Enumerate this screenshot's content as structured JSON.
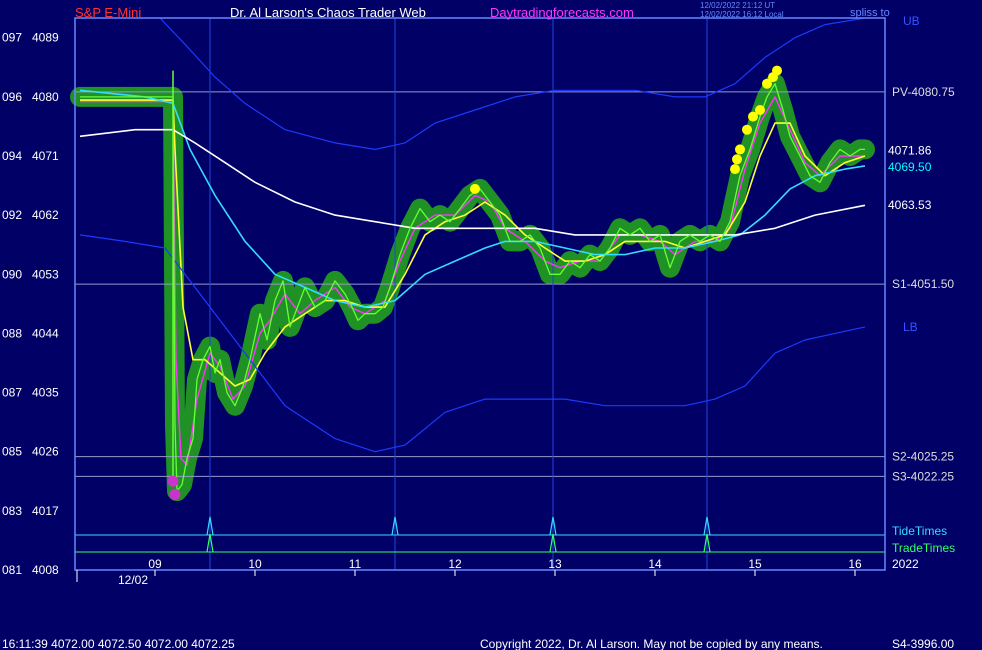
{
  "header": {
    "title": "S&P E-Mini",
    "author": "Dr. Al Larson's Chaos Trader Web",
    "site": "Daytradingforecasts.com",
    "timestamp_ut": "12/02/2022 21:12 UT",
    "timestamp_local": "12/02/2022 16:12 Local",
    "corner_label": "spliss to"
  },
  "footer": {
    "last_bar": "16:11:39  4072.00 4072.50 4072.00 4072.25",
    "copyright": "Copyright 2022, Dr. Al Larson. May not be copied by any means.",
    "s4_label": "S4-3996.00"
  },
  "axis": {
    "y_ticks": [
      {
        "left": "097",
        "right": "4089",
        "value": 4089
      },
      {
        "left": "096",
        "right": "4080",
        "value": 4080
      },
      {
        "left": "094",
        "right": "4071",
        "value": 4071
      },
      {
        "left": "092",
        "right": "4062",
        "value": 4062
      },
      {
        "left": "090",
        "right": "4053",
        "value": 4053
      },
      {
        "left": "088",
        "right": "4044",
        "value": 4044
      },
      {
        "left": "087",
        "right": "4035",
        "value": 4035
      },
      {
        "left": "085",
        "right": "4026",
        "value": 4026
      },
      {
        "left": "083",
        "right": "4017",
        "value": 4017
      },
      {
        "left": "081",
        "right": "4008",
        "value": 4008
      }
    ],
    "x_ticks": [
      {
        "label": "09",
        "hour": 9
      },
      {
        "label": "10",
        "hour": 10
      },
      {
        "label": "11",
        "hour": 11
      },
      {
        "label": "12",
        "hour": 12
      },
      {
        "label": "13",
        "hour": 13
      },
      {
        "label": "14",
        "hour": 14
      },
      {
        "label": "15",
        "hour": 15
      },
      {
        "label": "16",
        "hour": 16
      }
    ],
    "date_label": "12/02",
    "year_label": "2022",
    "x_range": [
      8.2,
      16.3
    ],
    "y_range": [
      4008,
      4092
    ]
  },
  "chart_data": {
    "type": "line",
    "levels": [
      {
        "label": "PV-4080.75",
        "value": 4080.75
      },
      {
        "label": "S1-4051.50",
        "value": 4051.5
      },
      {
        "label": "S2-4025.25",
        "value": 4025.25
      },
      {
        "label": "S3-4022.25",
        "value": 4022.25
      }
    ],
    "band_labels": {
      "upper": "UB",
      "lower": "LB"
    },
    "value_labels": [
      {
        "label": "4071.86",
        "value": 4071.86,
        "color": "#ffffff"
      },
      {
        "label": "4069.50",
        "value": 4069.5,
        "color": "#00ffff"
      },
      {
        "label": "4063.53",
        "value": 4063.53,
        "color": "#ffffff"
      }
    ],
    "price": [
      [
        8.25,
        4080.0
      ],
      [
        8.9,
        4080.0
      ],
      [
        9.18,
        4080.0
      ],
      [
        9.2,
        4030
      ],
      [
        9.22,
        4020
      ],
      [
        9.27,
        4021
      ],
      [
        9.32,
        4025
      ],
      [
        9.38,
        4028
      ],
      [
        9.42,
        4037
      ],
      [
        9.48,
        4040
      ],
      [
        9.55,
        4042
      ],
      [
        9.6,
        4038
      ],
      [
        9.65,
        4040
      ],
      [
        9.72,
        4035
      ],
      [
        9.8,
        4033
      ],
      [
        9.88,
        4036
      ],
      [
        9.95,
        4040
      ],
      [
        10.05,
        4047
      ],
      [
        10.12,
        4043
      ],
      [
        10.2,
        4049
      ],
      [
        10.28,
        4052
      ],
      [
        10.35,
        4045
      ],
      [
        10.4,
        4047
      ],
      [
        10.5,
        4051
      ],
      [
        10.6,
        4048
      ],
      [
        10.7,
        4049
      ],
      [
        10.8,
        4052
      ],
      [
        10.9,
        4050
      ],
      [
        10.97,
        4048
      ],
      [
        11.03,
        4046
      ],
      [
        11.1,
        4047
      ],
      [
        11.2,
        4047
      ],
      [
        11.28,
        4048
      ],
      [
        11.35,
        4051
      ],
      [
        11.45,
        4056
      ],
      [
        11.55,
        4060
      ],
      [
        11.65,
        4063
      ],
      [
        11.75,
        4061
      ],
      [
        11.85,
        4062
      ],
      [
        11.95,
        4061
      ],
      [
        12.05,
        4063
      ],
      [
        12.15,
        4065
      ],
      [
        12.25,
        4066
      ],
      [
        12.35,
        4064
      ],
      [
        12.45,
        4062
      ],
      [
        12.55,
        4058
      ],
      [
        12.65,
        4058
      ],
      [
        12.75,
        4059
      ],
      [
        12.85,
        4057
      ],
      [
        12.95,
        4053
      ],
      [
        13.05,
        4053
      ],
      [
        13.15,
        4055
      ],
      [
        13.25,
        4054
      ],
      [
        13.35,
        4056
      ],
      [
        13.45,
        4055
      ],
      [
        13.55,
        4057
      ],
      [
        13.65,
        4060
      ],
      [
        13.75,
        4059
      ],
      [
        13.85,
        4060
      ],
      [
        13.95,
        4058
      ],
      [
        14.05,
        4059
      ],
      [
        14.15,
        4054
      ],
      [
        14.25,
        4058
      ],
      [
        14.35,
        4059
      ],
      [
        14.45,
        4058
      ],
      [
        14.55,
        4059
      ],
      [
        14.65,
        4058
      ],
      [
        14.75,
        4061
      ],
      [
        14.85,
        4068
      ],
      [
        14.95,
        4072
      ],
      [
        15.05,
        4077
      ],
      [
        15.12,
        4080
      ],
      [
        15.2,
        4082
      ],
      [
        15.28,
        4078
      ],
      [
        15.35,
        4074
      ],
      [
        15.45,
        4071
      ],
      [
        15.55,
        4068
      ],
      [
        15.65,
        4067
      ],
      [
        15.75,
        4070
      ],
      [
        15.85,
        4072
      ],
      [
        15.95,
        4071
      ],
      [
        16.05,
        4072
      ],
      [
        16.1,
        4072
      ]
    ],
    "series": [
      {
        "key": "magenta",
        "color": "#ff33ff",
        "width": 1.4,
        "values": [
          [
            8.25,
            4079.3
          ],
          [
            9.18,
            4079.3
          ],
          [
            9.21,
            4040
          ],
          [
            9.26,
            4025
          ],
          [
            9.32,
            4024
          ],
          [
            9.42,
            4034
          ],
          [
            9.55,
            4041
          ],
          [
            9.65,
            4039
          ],
          [
            9.78,
            4034
          ],
          [
            9.9,
            4036
          ],
          [
            10.05,
            4044
          ],
          [
            10.15,
            4046
          ],
          [
            10.3,
            4050
          ],
          [
            10.45,
            4047
          ],
          [
            10.6,
            4049
          ],
          [
            10.8,
            4051
          ],
          [
            10.95,
            4048
          ],
          [
            11.1,
            4047
          ],
          [
            11.3,
            4049
          ],
          [
            11.45,
            4055
          ],
          [
            11.6,
            4060
          ],
          [
            11.8,
            4062
          ],
          [
            12.0,
            4062
          ],
          [
            12.2,
            4065
          ],
          [
            12.35,
            4064
          ],
          [
            12.5,
            4060
          ],
          [
            12.7,
            4058
          ],
          [
            12.9,
            4055
          ],
          [
            13.05,
            4054
          ],
          [
            13.25,
            4055
          ],
          [
            13.45,
            4055
          ],
          [
            13.65,
            4059
          ],
          [
            13.85,
            4059
          ],
          [
            14.05,
            4058
          ],
          [
            14.2,
            4056
          ],
          [
            14.4,
            4058
          ],
          [
            14.6,
            4058
          ],
          [
            14.75,
            4060
          ],
          [
            14.9,
            4069
          ],
          [
            15.05,
            4076
          ],
          [
            15.2,
            4080
          ],
          [
            15.35,
            4075
          ],
          [
            15.5,
            4070
          ],
          [
            15.65,
            4068
          ],
          [
            15.85,
            4071
          ],
          [
            16.1,
            4071
          ]
        ]
      },
      {
        "key": "yellow",
        "color": "#ffff33",
        "width": 1.6,
        "values": [
          [
            8.25,
            4079.5
          ],
          [
            9.18,
            4079.5
          ],
          [
            9.2,
            4072
          ],
          [
            9.28,
            4048
          ],
          [
            9.38,
            4040
          ],
          [
            9.5,
            4040
          ],
          [
            9.65,
            4038
          ],
          [
            9.8,
            4036
          ],
          [
            9.95,
            4037
          ],
          [
            10.1,
            4041
          ],
          [
            10.3,
            4045
          ],
          [
            10.5,
            4047
          ],
          [
            10.7,
            4049
          ],
          [
            10.9,
            4049
          ],
          [
            11.1,
            4048
          ],
          [
            11.3,
            4048
          ],
          [
            11.5,
            4053
          ],
          [
            11.7,
            4059
          ],
          [
            11.9,
            4061
          ],
          [
            12.1,
            4062
          ],
          [
            12.3,
            4064
          ],
          [
            12.5,
            4062
          ],
          [
            12.7,
            4059
          ],
          [
            12.9,
            4057
          ],
          [
            13.1,
            4055
          ],
          [
            13.3,
            4055
          ],
          [
            13.5,
            4056
          ],
          [
            13.7,
            4058
          ],
          [
            13.9,
            4058
          ],
          [
            14.1,
            4058
          ],
          [
            14.3,
            4057
          ],
          [
            14.5,
            4058
          ],
          [
            14.7,
            4059
          ],
          [
            14.9,
            4064
          ],
          [
            15.05,
            4071
          ],
          [
            15.2,
            4076
          ],
          [
            15.35,
            4076
          ],
          [
            15.5,
            4071
          ],
          [
            15.7,
            4068
          ],
          [
            15.9,
            4070
          ],
          [
            16.1,
            4071
          ]
        ]
      },
      {
        "key": "cyan",
        "color": "#33ddff",
        "width": 1.6,
        "values": [
          [
            8.25,
            4081
          ],
          [
            8.9,
            4080
          ],
          [
            9.18,
            4079
          ],
          [
            9.35,
            4072
          ],
          [
            9.6,
            4065
          ],
          [
            9.9,
            4058
          ],
          [
            10.2,
            4053
          ],
          [
            10.5,
            4051
          ],
          [
            10.8,
            4049
          ],
          [
            11.1,
            4048
          ],
          [
            11.4,
            4049
          ],
          [
            11.7,
            4053
          ],
          [
            12.0,
            4055
          ],
          [
            12.3,
            4057
          ],
          [
            12.5,
            4058
          ],
          [
            12.8,
            4058
          ],
          [
            13.1,
            4057
          ],
          [
            13.4,
            4056
          ],
          [
            13.7,
            4056
          ],
          [
            14.0,
            4057
          ],
          [
            14.3,
            4057
          ],
          [
            14.6,
            4058
          ],
          [
            14.85,
            4059
          ],
          [
            15.1,
            4062
          ],
          [
            15.35,
            4066
          ],
          [
            15.6,
            4068
          ],
          [
            15.9,
            4069
          ],
          [
            16.1,
            4069.5
          ]
        ]
      },
      {
        "key": "white",
        "color": "#ffffff",
        "width": 1.6,
        "values": [
          [
            8.25,
            4074
          ],
          [
            8.8,
            4075
          ],
          [
            9.18,
            4075
          ],
          [
            9.4,
            4073
          ],
          [
            9.7,
            4070
          ],
          [
            10.0,
            4067
          ],
          [
            10.4,
            4064
          ],
          [
            10.8,
            4062
          ],
          [
            11.2,
            4061
          ],
          [
            11.6,
            4060
          ],
          [
            12.0,
            4060
          ],
          [
            12.4,
            4060
          ],
          [
            12.8,
            4060
          ],
          [
            13.2,
            4059
          ],
          [
            13.6,
            4059
          ],
          [
            14.0,
            4059
          ],
          [
            14.4,
            4059
          ],
          [
            14.8,
            4059
          ],
          [
            15.2,
            4060
          ],
          [
            15.6,
            4062
          ],
          [
            16.1,
            4063.5
          ]
        ]
      },
      {
        "key": "ub",
        "color": "#1a3aff",
        "width": 1.2,
        "values": [
          [
            9.05,
            4092
          ],
          [
            9.3,
            4088
          ],
          [
            9.6,
            4083
          ],
          [
            9.9,
            4079
          ],
          [
            10.3,
            4075
          ],
          [
            10.8,
            4073
          ],
          [
            11.2,
            4072
          ],
          [
            11.5,
            4073
          ],
          [
            11.8,
            4076
          ],
          [
            12.2,
            4078
          ],
          [
            12.6,
            4080
          ],
          [
            13.0,
            4081
          ],
          [
            13.4,
            4081
          ],
          [
            13.8,
            4081
          ],
          [
            14.2,
            4080
          ],
          [
            14.5,
            4080
          ],
          [
            14.8,
            4082
          ],
          [
            15.1,
            4086
          ],
          [
            15.4,
            4089
          ],
          [
            15.7,
            4091
          ],
          [
            16.1,
            4092
          ]
        ]
      },
      {
        "key": "lb",
        "color": "#1a3aff",
        "width": 1.2,
        "values": [
          [
            8.25,
            4059
          ],
          [
            8.7,
            4058
          ],
          [
            9.1,
            4057
          ],
          [
            9.4,
            4051
          ],
          [
            9.8,
            4043
          ],
          [
            10.3,
            4033
          ],
          [
            10.8,
            4028
          ],
          [
            11.2,
            4026
          ],
          [
            11.5,
            4027
          ],
          [
            11.9,
            4032
          ],
          [
            12.3,
            4034
          ],
          [
            12.7,
            4034
          ],
          [
            13.1,
            4034
          ],
          [
            13.5,
            4033
          ],
          [
            13.9,
            4033
          ],
          [
            14.3,
            4033
          ],
          [
            14.6,
            4034
          ],
          [
            14.9,
            4036
          ],
          [
            15.2,
            4041
          ],
          [
            15.5,
            4043
          ],
          [
            15.8,
            4044
          ],
          [
            16.1,
            4045
          ]
        ]
      }
    ],
    "green_spike": {
      "x": 9.18,
      "values": [
        4022,
        4084
      ]
    },
    "yellow_dots": [
      [
        12.2,
        4066
      ],
      [
        14.8,
        4069
      ],
      [
        14.82,
        4070.5
      ],
      [
        14.85,
        4072
      ],
      [
        14.92,
        4075
      ],
      [
        14.98,
        4077
      ],
      [
        15.05,
        4078
      ],
      [
        15.12,
        4082
      ],
      [
        15.18,
        4083
      ],
      [
        15.22,
        4084
      ]
    ],
    "magenta_dots": [
      [
        9.18,
        4021.5
      ],
      [
        9.2,
        4019.5
      ]
    ],
    "event_lines": [
      9.55,
      11.4,
      12.98,
      14.52
    ],
    "tide_times": {
      "label": "TideTimes",
      "color": "#33ddff",
      "spikes": [
        9.55,
        11.4,
        12.98,
        14.52
      ]
    },
    "trade_times": {
      "label": "TradeTimes",
      "color": "#33ff66",
      "spikes": [
        9.55,
        12.98,
        14.52
      ]
    }
  },
  "colors": {
    "background": "#000066",
    "frame": "#6688ff",
    "text": "#ffffff",
    "title": "#ff3333",
    "site": "#ff33ff",
    "price": "#66ff33",
    "halo": "#229922",
    "ub_lb_label": "#3355ff"
  }
}
